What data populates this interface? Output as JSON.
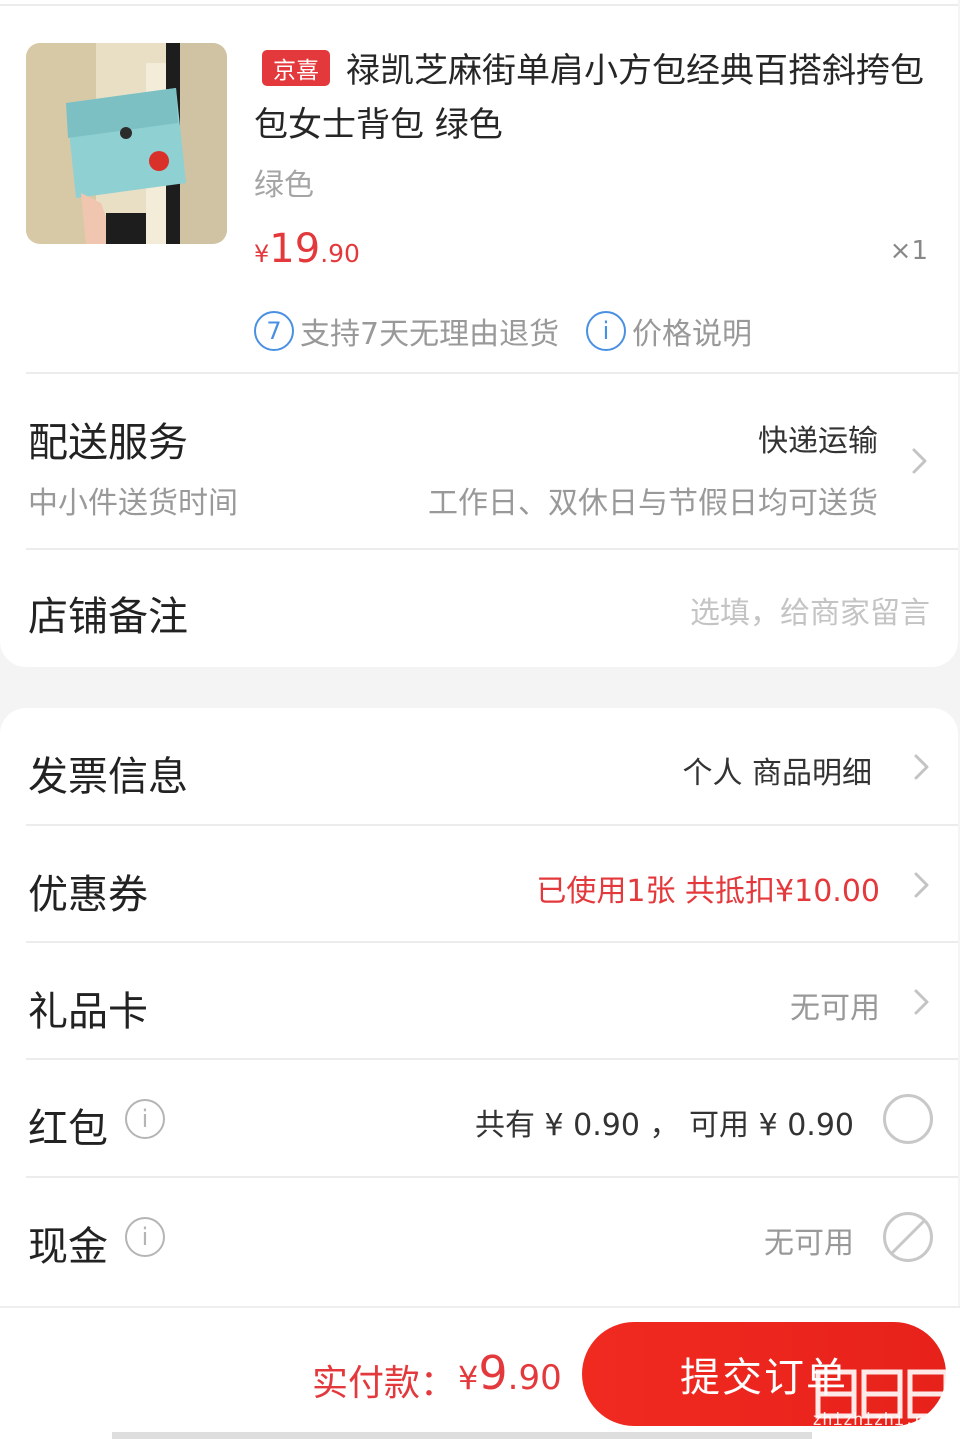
{
  "product": {
    "badge": "京喜",
    "title": "禄凯芝麻街单肩小方包经典百搭斜挎包包女士背包 绿色",
    "spec": "绿色",
    "price_currency": "¥",
    "price_integer": "19",
    "price_decimal": ".90",
    "quantity": "×1",
    "service_icon": "7",
    "service_text": "支持7天无理由退货",
    "price_info_icon": "i",
    "price_info_text": "价格说明"
  },
  "delivery": {
    "label": "配送服务",
    "value": "快递运输",
    "sub_label": "中小件送货时间",
    "sub_value": "工作日、双休日与节假日均可送货"
  },
  "remark": {
    "label": "店铺备注",
    "placeholder": "选填，给商家留言"
  },
  "invoice": {
    "label": "发票信息",
    "value": "个人 商品明细"
  },
  "coupon": {
    "label": "优惠券",
    "value": "已使用1张 共抵扣¥10.00"
  },
  "giftcard": {
    "label": "礼品卡",
    "value": "无可用"
  },
  "redpacket": {
    "label": "红包",
    "value": "共有 ¥ 0.90 ， 可用 ¥ 0.90"
  },
  "cash": {
    "label": "现金",
    "value": "无可用"
  },
  "footer": {
    "pay_label": "实付款：",
    "pay_currency": "¥",
    "pay_integer": "9",
    "pay_decimal": ".90",
    "submit_label": "提交订单",
    "watermark": "zhizhizhi.com"
  },
  "colors": {
    "accent": "#e4393c",
    "info_blue": "#4a90e2"
  }
}
